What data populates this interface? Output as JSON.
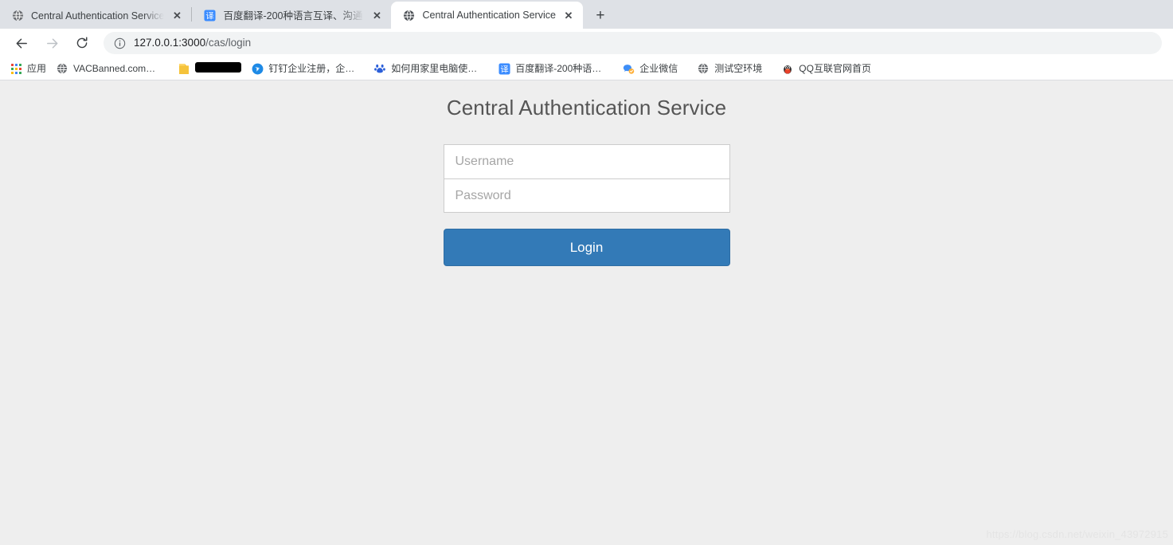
{
  "browser": {
    "tabs": [
      {
        "title": "Central Authentication Service",
        "favicon": "globe-icon",
        "active": false,
        "close_label": "✕"
      },
      {
        "title": "百度翻译-200种语言互译、沟通…",
        "favicon": "baidu-translate-icon",
        "active": false,
        "close_label": "✕"
      },
      {
        "title": "Central Authentication Service",
        "favicon": "globe-icon",
        "active": true,
        "close_label": "✕"
      }
    ],
    "new_tab_label": "+",
    "toolbar": {
      "back_label": "←",
      "forward_label": "→",
      "reload_label": "⟳",
      "info_icon": "info-circle-icon",
      "url_host": "127.0.0.1:3000",
      "url_path": "/cas/login",
      "url_full": "127.0.0.1:3000/cas/login"
    },
    "bookmarks": [
      {
        "label": "应用",
        "icon": "apps-grid-icon",
        "redacted": false
      },
      {
        "label": "VACBanned.com…",
        "icon": "globe-icon",
        "redacted": false
      },
      {
        "label": "",
        "icon": "folder-icon",
        "redacted": true
      },
      {
        "label": "钉钉企业注册，企…",
        "icon": "dingtalk-icon",
        "redacted": false
      },
      {
        "label": "如何用家里电脑使…",
        "icon": "baidu-paw-icon",
        "redacted": false
      },
      {
        "label": "百度翻译-200种语…",
        "icon": "baidu-translate-icon",
        "redacted": false
      },
      {
        "label": "企业微信",
        "icon": "wecom-icon",
        "redacted": false
      },
      {
        "label": "测试空环境",
        "icon": "globe-icon",
        "redacted": false
      },
      {
        "label": "QQ互联官网首页",
        "icon": "qq-penguin-icon",
        "redacted": false
      }
    ]
  },
  "page": {
    "title": "Central Authentication Service",
    "username": {
      "value": "",
      "placeholder": "Username"
    },
    "password": {
      "value": "",
      "placeholder": "Password"
    },
    "login_button": "Login",
    "watermark": "https://blog.csdn.net/weixin_43972915",
    "colors": {
      "background": "#eeeeee",
      "primary": "#337ab7",
      "primary_border": "#2e6da4",
      "title_text": "#555555",
      "placeholder": "#a5a5a5",
      "field_border": "#cccccc"
    }
  }
}
